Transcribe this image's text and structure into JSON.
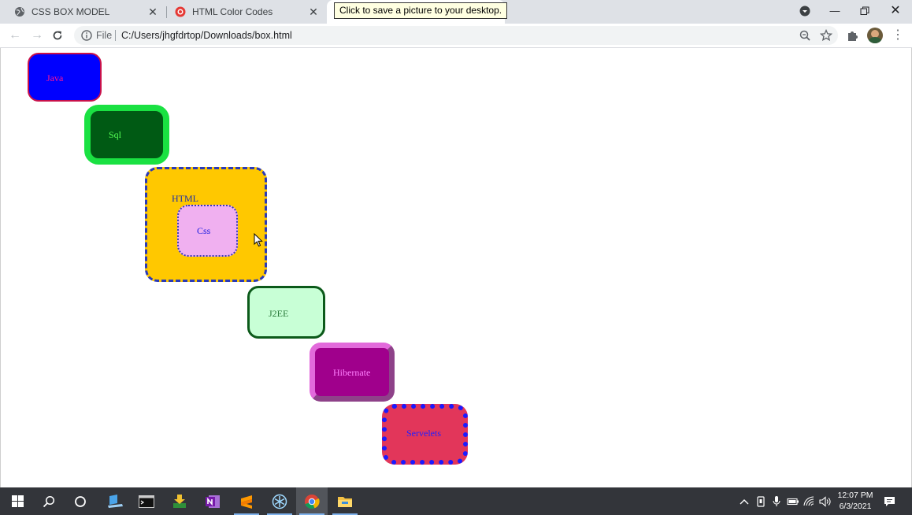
{
  "browser": {
    "tabs": [
      {
        "title": "CSS BOX MODEL",
        "icon": "globe-icon"
      },
      {
        "title": "HTML Color Codes",
        "icon": "html-color-codes-favicon"
      }
    ],
    "tooltip": "Click to save a picture to your desktop.",
    "address": {
      "scheme_label": "File",
      "url": "C:/Users/jhgfdrtop/Downloads/box.html"
    }
  },
  "page": {
    "boxes": {
      "java": "Java",
      "sql": "Sql",
      "html": "HTML",
      "css": "Css",
      "j2ee": "J2EE",
      "hibernate": "Hibernate",
      "servelets": "Servelets"
    }
  },
  "taskbar": {
    "apps": [
      "start-icon",
      "search-icon",
      "task-view-icon",
      "file-transfer-icon",
      "terminal-icon",
      "download-manager-icon",
      "onenote-icon",
      "sublime-text-icon",
      "snowflake-app-icon",
      "chrome-icon",
      "file-explorer-icon"
    ],
    "clock": {
      "time": "12:07 PM",
      "date": "6/3/2021"
    }
  },
  "colors": {
    "java_bg": "#0000ff",
    "sql_bg": "#005a14",
    "html_bg": "#ffc800",
    "css_bg": "#f0b0f0",
    "j2ee_bg": "#c8ffd6",
    "hibernate_bg": "#a0008c",
    "servelets_bg": "#e2365a"
  }
}
